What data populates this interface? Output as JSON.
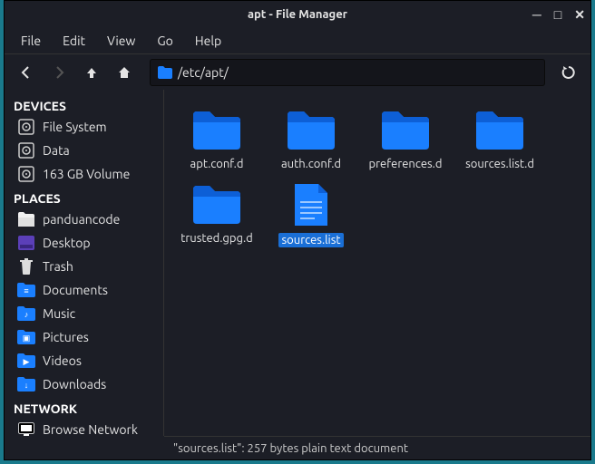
{
  "titlebar": {
    "title": "apt - File Manager"
  },
  "menubar": [
    "File",
    "Edit",
    "View",
    "Go",
    "Help"
  ],
  "location": {
    "path": "/etc/apt/"
  },
  "sidebar": {
    "sections": [
      {
        "header": "DEVICES",
        "items": [
          {
            "icon": "disk",
            "label": "File System"
          },
          {
            "icon": "disk",
            "label": "Data"
          },
          {
            "icon": "disk",
            "label": "163 GB Volume"
          }
        ]
      },
      {
        "header": "PLACES",
        "items": [
          {
            "icon": "home",
            "label": "panduancode"
          },
          {
            "icon": "desktop",
            "label": "Desktop"
          },
          {
            "icon": "trash",
            "label": "Trash"
          },
          {
            "icon": "folder-docs",
            "label": "Documents"
          },
          {
            "icon": "folder-music",
            "label": "Music"
          },
          {
            "icon": "folder-pics",
            "label": "Pictures"
          },
          {
            "icon": "folder-video",
            "label": "Videos"
          },
          {
            "icon": "folder-down",
            "label": "Downloads"
          }
        ]
      },
      {
        "header": "NETWORK",
        "items": [
          {
            "icon": "network",
            "label": "Browse Network"
          }
        ]
      }
    ]
  },
  "files": [
    {
      "type": "folder",
      "name": "apt.conf.d",
      "selected": false
    },
    {
      "type": "folder",
      "name": "auth.conf.d",
      "selected": false
    },
    {
      "type": "folder",
      "name": "preferences.d",
      "selected": false
    },
    {
      "type": "folder",
      "name": "sources.list.d",
      "selected": false
    },
    {
      "type": "folder",
      "name": "trusted.gpg.d",
      "selected": false
    },
    {
      "type": "file",
      "name": "sources.list",
      "selected": true
    }
  ],
  "statusbar": {
    "text": "\"sources.list\": 257 bytes plain text document"
  }
}
